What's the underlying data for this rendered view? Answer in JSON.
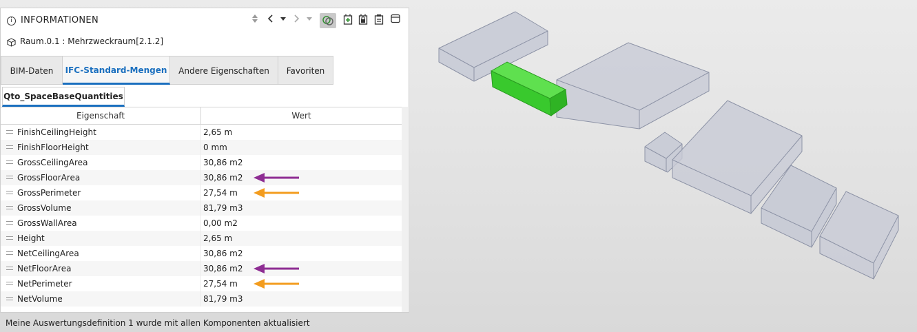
{
  "header": {
    "title": "INFORMATIONEN",
    "info_icon": "info-icon",
    "toolbar_icons": [
      "sort-updown-icon",
      "chevron-left-icon",
      "caret-down-icon",
      "chevron-right-icon",
      "caret-down-icon",
      "link-icon",
      "add-document-icon",
      "lock-document-icon",
      "clipboard-icon",
      "window-icon"
    ]
  },
  "subheader": {
    "icon": "cube-icon",
    "text": "Raum.0.1 : Mehrzweckraum[2.1.2]"
  },
  "tabs": [
    {
      "label": "BIM-Daten",
      "active": false
    },
    {
      "label": "IFC-Standard-Mengen",
      "active": true
    },
    {
      "label": "Andere Eigenschaften",
      "active": false
    },
    {
      "label": "Favoriten",
      "active": false
    }
  ],
  "subtab": {
    "label": "Qto_SpaceBaseQuantities"
  },
  "table": {
    "columns": [
      "Eigenschaft",
      "Wert"
    ],
    "rows": [
      {
        "name": "FinishCeilingHeight",
        "value": "2,65 m"
      },
      {
        "name": "FinishFloorHeight",
        "value": "0 mm"
      },
      {
        "name": "GrossCeilingArea",
        "value": "30,86 m2"
      },
      {
        "name": "GrossFloorArea",
        "value": "30,86 m2"
      },
      {
        "name": "GrossPerimeter",
        "value": "27,54 m"
      },
      {
        "name": "GrossVolume",
        "value": "81,79 m3"
      },
      {
        "name": "GrossWallArea",
        "value": "0,00 m2"
      },
      {
        "name": "Height",
        "value": "2,65 m"
      },
      {
        "name": "NetCeilingArea",
        "value": "30,86 m2"
      },
      {
        "name": "NetFloorArea",
        "value": "30,86 m2"
      },
      {
        "name": "NetPerimeter",
        "value": "27,54 m"
      },
      {
        "name": "NetVolume",
        "value": "81,79 m3"
      }
    ]
  },
  "arrows": [
    {
      "row": 3,
      "color": "#8e2d93"
    },
    {
      "row": 4,
      "color": "#f39c1e"
    },
    {
      "row": 9,
      "color": "#8e2d93"
    },
    {
      "row": 10,
      "color": "#f39c1e"
    }
  ],
  "status": {
    "text": "Meine Auswertungsdefinition 1 wurde mit allen Komponenten aktualisiert"
  },
  "colors": {
    "accent": "#1a6fbf",
    "selected_space": "#39c92d",
    "space_box": "#c9ccd6"
  }
}
